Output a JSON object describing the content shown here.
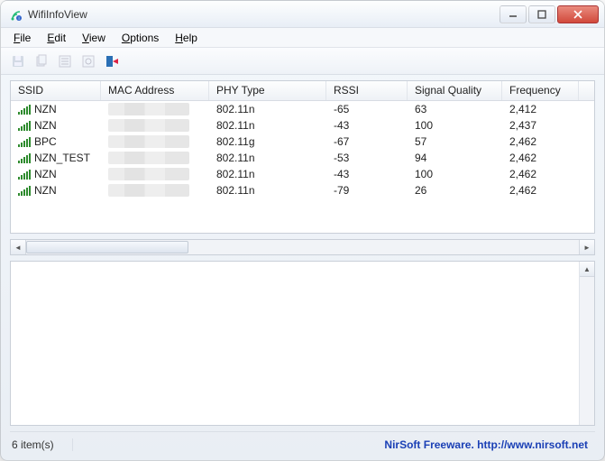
{
  "window": {
    "title": "WifiInfoView"
  },
  "menu": {
    "file": "File",
    "edit": "Edit",
    "view": "View",
    "options": "Options",
    "help": "Help"
  },
  "columns": {
    "ssid": "SSID",
    "mac": "MAC Address",
    "phy": "PHY Type",
    "rssi": "RSSI",
    "signal": "Signal Quality",
    "freq": "Frequency"
  },
  "rows": [
    {
      "ssid": "NZN",
      "phy": "802.11n",
      "rssi": "-65",
      "signal": "63",
      "freq": "2,412"
    },
    {
      "ssid": "NZN",
      "phy": "802.11n",
      "rssi": "-43",
      "signal": "100",
      "freq": "2,437"
    },
    {
      "ssid": "BPC",
      "phy": "802.11g",
      "rssi": "-67",
      "signal": "57",
      "freq": "2,462"
    },
    {
      "ssid": "NZN_TEST",
      "phy": "802.11n",
      "rssi": "-53",
      "signal": "94",
      "freq": "2,462"
    },
    {
      "ssid": "NZN",
      "phy": "802.11n",
      "rssi": "-43",
      "signal": "100",
      "freq": "2,462"
    },
    {
      "ssid": "NZN",
      "phy": "802.11n",
      "rssi": "-79",
      "signal": "26",
      "freq": "2,462"
    }
  ],
  "status": {
    "count": "6 item(s)",
    "credit": "NirSoft Freeware.  http://www.nirsoft.net"
  }
}
